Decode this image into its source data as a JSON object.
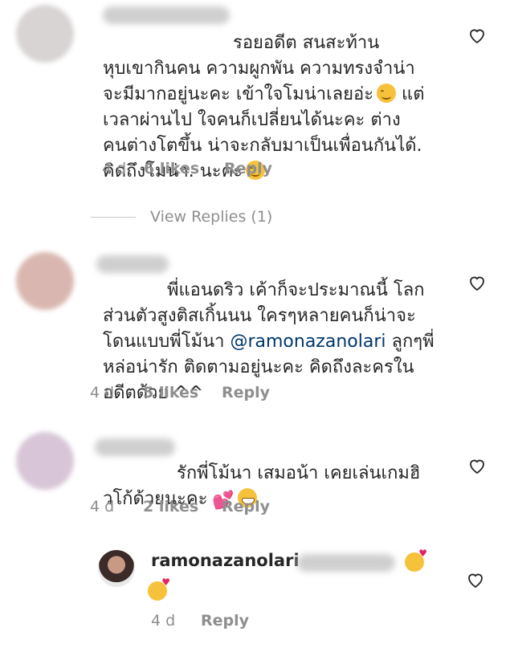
{
  "comments": [
    {
      "text": "รอยอดีต สนสะท้าน\nหุบเขากินคน  ความผูกพัน ความทรงจำน่า\nจะมีมากอยู่นะคะ เข้าใจโมน่าเลยอ่ะ",
      "text2": " แต่\nเวลาผ่านไป ใจคนก็เปลี่ยนได้นะคะ ต่าง\nคนต่างโตขึ้น น่าจะกลับมาเป็นเพื่อนกันได้.\nคิดถึงโมน่า. นะคะ",
      "time": "4 d",
      "likes": "6 likes",
      "reply": "Reply",
      "view_replies": "View Replies (1)"
    },
    {
      "text": "พี่แอนดริว เค้าก็จะประมาณนี้ โลก\nส่วนตัวสูงติสเกิ้นนน  ใครๆหลายคนก็น่าจะ\nโดนแบบพี่โม้นา ",
      "mention": "@ramonazanolari",
      "text2": "  ลูกๆพี่\nหล่อน่ารัก ติดตามอยู่นะคะ คิดถึงละครใน\nอดีตด้วย ^^",
      "time": "4 d",
      "likes": "5 likes",
      "reply": "Reply"
    },
    {
      "text": "รักพี่โม้นา เสมอน้า เคยเล่นเกมฮิ\nวโก้ด้วยนะคะ",
      "time": "4 d",
      "likes": "2 likes",
      "reply": "Reply"
    },
    {
      "username": "ramonazanolari",
      "time": "4 d",
      "reply": "Reply"
    }
  ],
  "icons": {
    "heart": "heart-outline-icon",
    "smile": "smiling-face-icon",
    "kiss": "face-blowing-kiss-icon",
    "grin": "grinning-face-icon",
    "two_hearts": "two-hearts-icon"
  },
  "colors": {
    "meta": "#8e8e8e",
    "mention": "#00376b",
    "text": "#262626"
  }
}
